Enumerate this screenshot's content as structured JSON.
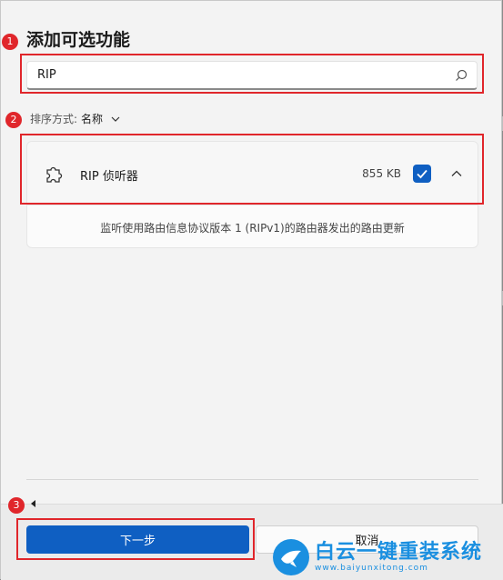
{
  "dialog": {
    "title": "添加可选功能",
    "search": {
      "value": "RIP"
    },
    "sort": {
      "label": "排序方式:",
      "value": "名称"
    },
    "feature": {
      "name": "RIP 侦听器",
      "size": "855 KB",
      "checked": true,
      "description": "监听使用路由信息协议版本 1 (RIPv1)的路由器发出的路由更新"
    },
    "buttons": {
      "next": "下一步",
      "cancel": "取消"
    }
  },
  "annotations": [
    "1",
    "2",
    "3"
  ],
  "watermark": {
    "main": "白云一键重装系统",
    "sub": "www.baiyunxitong.com"
  },
  "colors": {
    "accent": "#0f5fc2",
    "annotation": "#e0262b",
    "watermark": "#1a8fe0"
  }
}
